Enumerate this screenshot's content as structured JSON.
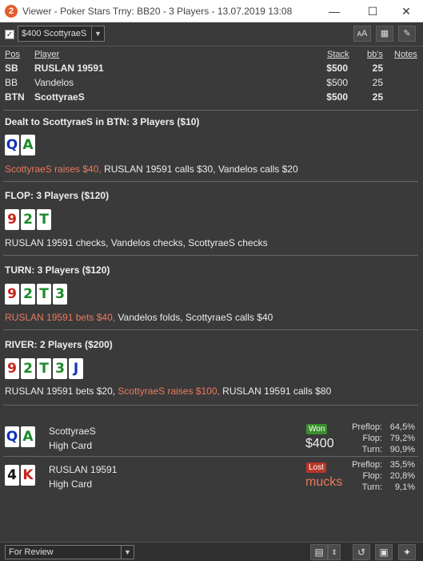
{
  "window": {
    "title": "Viewer - Poker Stars Trny: BB20 - 3 Players - 13.07.2019 13:08",
    "logo": "2"
  },
  "toolbar": {
    "hand_select_value": "$400 ScottyraeS"
  },
  "players_header": {
    "pos": "Pos",
    "player": "Player",
    "stack": "Stack",
    "bbs": "bb's",
    "notes": "Notes"
  },
  "players": [
    {
      "pos": "SB",
      "name": "RUSLAN 19591",
      "stack": "$500",
      "bbs": "25"
    },
    {
      "pos": "BB",
      "name": "Vandelos",
      "stack": "$500",
      "bbs": "25"
    },
    {
      "pos": "BTN",
      "name": "ScottyraeS",
      "stack": "$500",
      "bbs": "25"
    }
  ],
  "streets": {
    "preflop": {
      "title": "Dealt to ScottyraeS in BTN: 3 Players ($10)",
      "cards": [
        {
          "rank": "Q",
          "suit": "d"
        },
        {
          "rank": "A",
          "suit": "c"
        }
      ],
      "action_hero": "ScottyraeS raises $40,",
      "action_rest": " RUSLAN 19591 calls $30, Vandelos calls $20"
    },
    "flop": {
      "title": "FLOP: 3 Players ($120)",
      "cards": [
        {
          "rank": "9",
          "suit": "h"
        },
        {
          "rank": "2",
          "suit": "c"
        },
        {
          "rank": "T",
          "suit": "c"
        }
      ],
      "action": "RUSLAN 19591 checks, Vandelos checks, ScottyraeS checks"
    },
    "turn": {
      "title": "TURN: 3 Players ($120)",
      "cards": [
        {
          "rank": "9",
          "suit": "h"
        },
        {
          "rank": "2",
          "suit": "c"
        },
        {
          "rank": "T",
          "suit": "c"
        },
        {
          "rank": "3",
          "suit": "c"
        }
      ],
      "action_hero": "RUSLAN 19591 bets $40,",
      "action_rest": " Vandelos folds, ScottyraeS calls $40"
    },
    "river": {
      "title": "RIVER: 2 Players ($200)",
      "cards": [
        {
          "rank": "9",
          "suit": "h"
        },
        {
          "rank": "2",
          "suit": "c"
        },
        {
          "rank": "T",
          "suit": "c"
        },
        {
          "rank": "3",
          "suit": "c"
        },
        {
          "rank": "J",
          "suit": "d"
        }
      ],
      "action_a": "RUSLAN 19591 bets $20, ",
      "action_hero": "ScottyraeS raises $100,",
      "action_b": " RUSLAN 19591 calls $80"
    }
  },
  "results": [
    {
      "cards": [
        {
          "rank": "Q",
          "suit": "d"
        },
        {
          "rank": "A",
          "suit": "c"
        }
      ],
      "name": "ScottyraeS",
      "hand": "High Card",
      "badge": "Won",
      "amount": "$400",
      "equity": [
        {
          "label": "Preflop:",
          "value": "64,5%"
        },
        {
          "label": "Flop:",
          "value": "79,2%"
        },
        {
          "label": "Turn:",
          "value": "90,9%"
        }
      ]
    },
    {
      "cards": [
        {
          "rank": "4",
          "suit": "s"
        },
        {
          "rank": "K",
          "suit": "h"
        }
      ],
      "name": "RUSLAN 19591",
      "hand": "High Card",
      "badge": "Lost",
      "amount": "mucks",
      "equity": [
        {
          "label": "Preflop:",
          "value": "35,5%"
        },
        {
          "label": "Flop:",
          "value": "20,8%"
        },
        {
          "label": "Turn:",
          "value": "9,1%"
        }
      ]
    }
  ],
  "bottom": {
    "status_value": "For Review"
  }
}
